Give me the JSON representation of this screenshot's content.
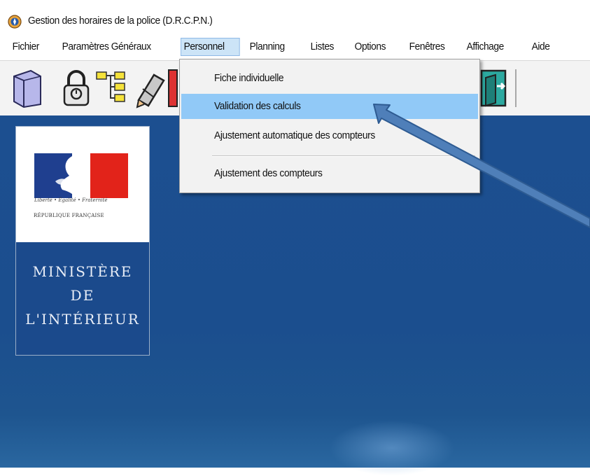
{
  "window": {
    "title": "Gestion des horaires de la police (D.R.C.P.N.)",
    "icon": "app-emblem-icon"
  },
  "menubar": {
    "items": [
      {
        "label": "Fichier"
      },
      {
        "label": "Paramètres Généraux"
      },
      {
        "label": "Personnel",
        "active": true
      },
      {
        "label": "Planning"
      },
      {
        "label": "Listes"
      },
      {
        "label": "Options"
      },
      {
        "label": "Fenêtres"
      },
      {
        "label": "Affichage"
      },
      {
        "label": "Aide"
      }
    ]
  },
  "toolbar": {
    "buttons": [
      {
        "icon": "folder-icon"
      },
      {
        "icon": "padlock-icon"
      },
      {
        "icon": "tree-structure-icon"
      },
      {
        "icon": "edit-pencil-icon"
      },
      {
        "icon": "exit-door-icon"
      }
    ]
  },
  "dropdown": {
    "menu": "Personnel",
    "items": [
      {
        "label": "Fiche individuelle"
      },
      {
        "label": "Validation des calculs",
        "highlighted": true
      },
      {
        "label": "Ajustement automatique des compteurs"
      },
      {
        "label": "Ajustement des compteurs"
      }
    ]
  },
  "logo": {
    "motto": "Liberté • Égalité • Fraternité",
    "republic": "RÉPUBLIQUE FRANÇAISE",
    "ministry_lines": [
      "MINISTÈRE",
      "DE",
      "L'INTÉRIEUR"
    ]
  },
  "colors": {
    "desktop_background": "#1c4f90",
    "menu_highlight": "#91c9f7",
    "active_menu": "#cce4f7",
    "arrow": "#4f7fb9",
    "flag_blue": "#1f3f8f",
    "flag_red": "#e2231a"
  },
  "annotation": {
    "arrow_target": "Validation des calculs"
  }
}
